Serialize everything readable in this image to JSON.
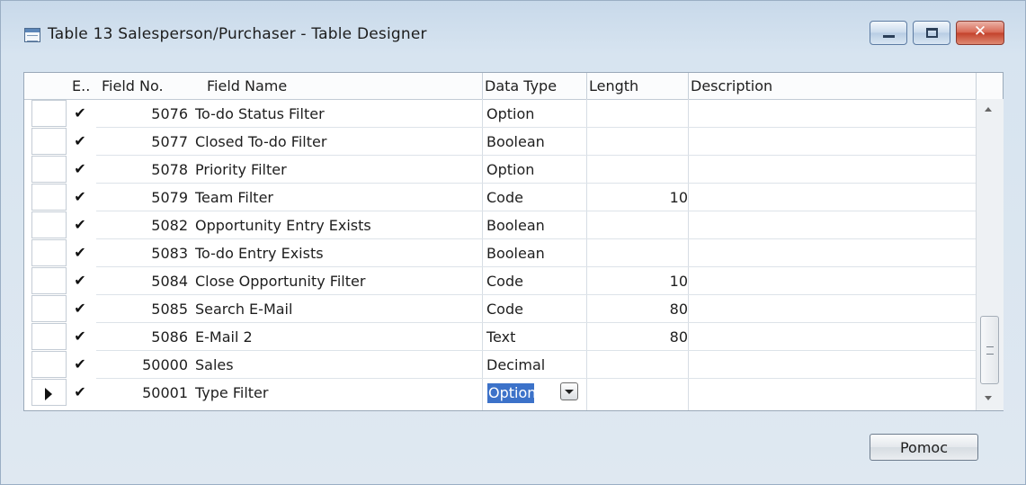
{
  "window": {
    "title": "Table 13 Salesperson/Purchaser - Table Designer",
    "close_label": "✕"
  },
  "columns": {
    "enabled": "E..",
    "field_no": "Field No.",
    "field_name": "Field Name",
    "data_type": "Data Type",
    "length": "Length",
    "description": "Description"
  },
  "rows": [
    {
      "enabled": "✔",
      "field_no": "5076",
      "field_name": "To-do Status Filter",
      "data_type": "Option",
      "length": ""
    },
    {
      "enabled": "✔",
      "field_no": "5077",
      "field_name": "Closed To-do Filter",
      "data_type": "Boolean",
      "length": ""
    },
    {
      "enabled": "✔",
      "field_no": "5078",
      "field_name": "Priority Filter",
      "data_type": "Option",
      "length": ""
    },
    {
      "enabled": "✔",
      "field_no": "5079",
      "field_name": "Team Filter",
      "data_type": "Code",
      "length": "10"
    },
    {
      "enabled": "✔",
      "field_no": "5082",
      "field_name": "Opportunity Entry Exists",
      "data_type": "Boolean",
      "length": ""
    },
    {
      "enabled": "✔",
      "field_no": "5083",
      "field_name": "To-do Entry Exists",
      "data_type": "Boolean",
      "length": ""
    },
    {
      "enabled": "✔",
      "field_no": "5084",
      "field_name": "Close Opportunity Filter",
      "data_type": "Code",
      "length": "10"
    },
    {
      "enabled": "✔",
      "field_no": "5085",
      "field_name": "Search E-Mail",
      "data_type": "Code",
      "length": "80"
    },
    {
      "enabled": "✔",
      "field_no": "5086",
      "field_name": "E-Mail 2",
      "data_type": "Text",
      "length": "80"
    },
    {
      "enabled": "✔",
      "field_no": "50000",
      "field_name": "Sales",
      "data_type": "Decimal",
      "length": ""
    },
    {
      "enabled": "✔",
      "field_no": "50001",
      "field_name": "Type Filter",
      "data_type": "Option",
      "length": ""
    }
  ],
  "buttons": {
    "help": "Pomoc"
  },
  "colors": {
    "selection": "#3c72c9",
    "close_button": "#c3412b"
  }
}
